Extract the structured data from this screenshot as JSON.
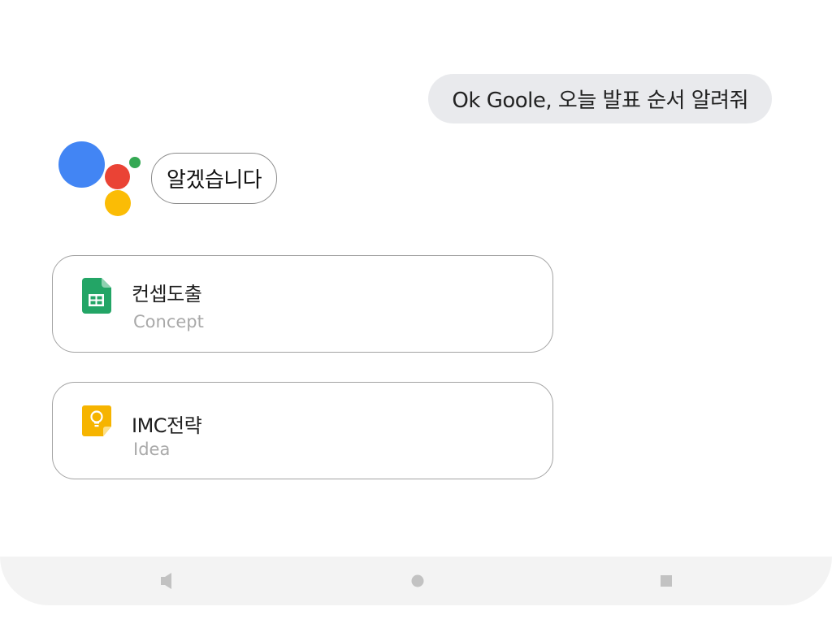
{
  "conversation": {
    "user_query": "Ok Goole, 오늘 발표 순서 알려줘",
    "assistant_reply": "알겠습니다"
  },
  "assistant_logo": {
    "colors": {
      "blue": "#4285F4",
      "red": "#EA4335",
      "yellow": "#FBBC05",
      "green": "#34A853"
    }
  },
  "results": [
    {
      "title": "컨셉도출",
      "subtitle": "Concept",
      "icon": "google-sheets-icon",
      "icon_color": "#23A566"
    },
    {
      "title": "IMC전략",
      "subtitle": "Idea",
      "icon": "google-keep-icon",
      "icon_color": "#F6B400"
    }
  ],
  "nav_bar": {
    "buttons": [
      "back-triangle-icon",
      "home-circle-icon",
      "recents-square-icon"
    ],
    "icon_color": "#c2c2c2"
  }
}
